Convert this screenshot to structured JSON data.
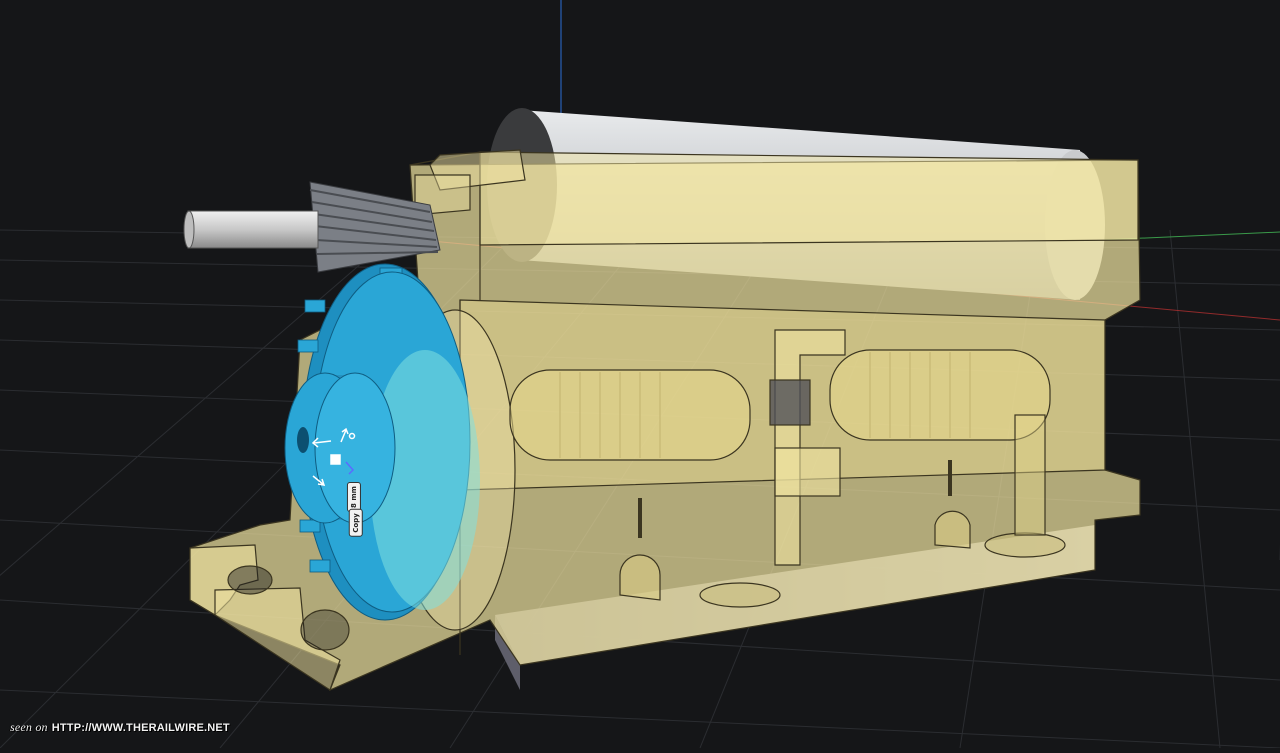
{
  "viewport": {
    "scene": "Motor and gearbox housing assembly",
    "selected_part": "Blue spur gear"
  },
  "gizmo": {
    "size_tag": "8 mm",
    "copy_tag": "Copy"
  },
  "watermark": {
    "prefix": "seen on",
    "url": "HTTP://WWW.THERAILWIRE.NET"
  },
  "colors": {
    "background": "#151618",
    "grid": "#2b2d31",
    "housing": "#efe2a0",
    "gear": "#2aa6d6",
    "pinion": "#7b7f86",
    "motor_can": "#d7d9db"
  }
}
